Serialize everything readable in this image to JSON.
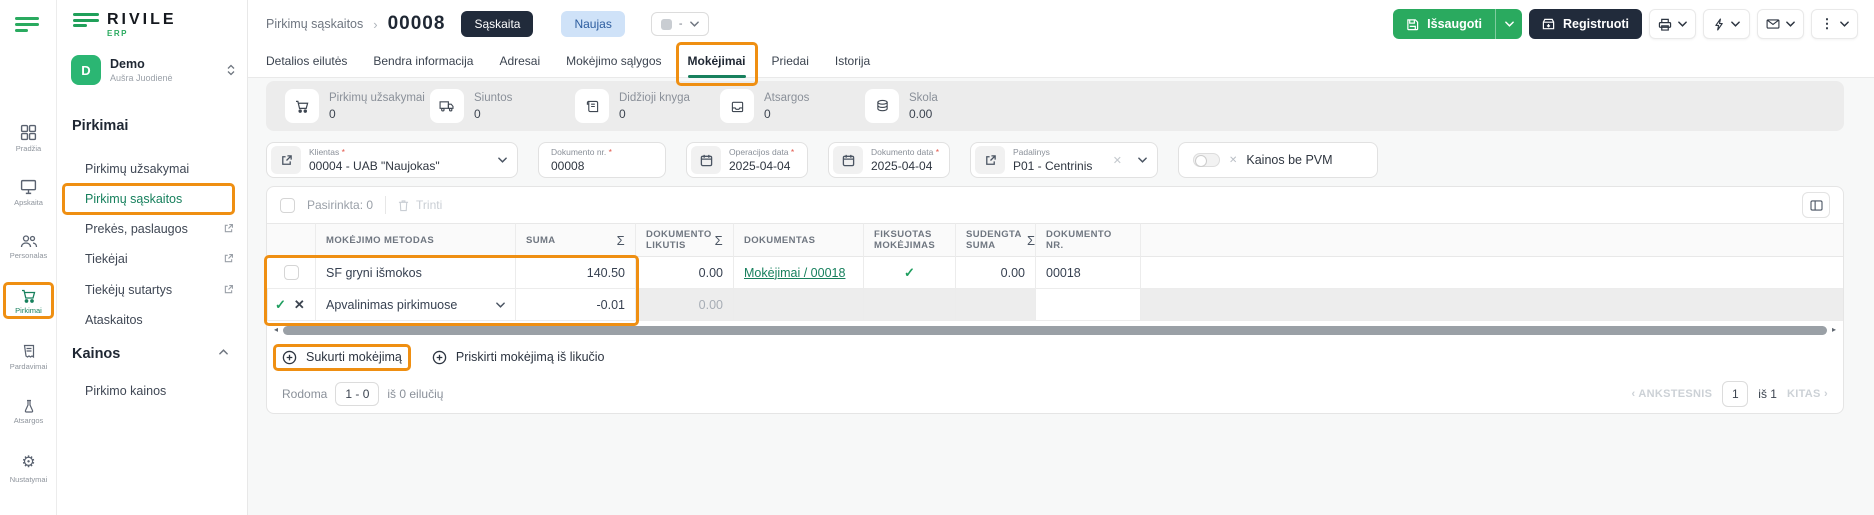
{
  "brand": {
    "name": "RIVILE",
    "sub": "ERP"
  },
  "user": {
    "initial": "D",
    "name": "Demo",
    "subtitle": "Aušra Juodienė"
  },
  "rail": {
    "items": [
      {
        "label": "Pradžia"
      },
      {
        "label": "Apskaita"
      },
      {
        "label": "Personalas"
      },
      {
        "label": "Pirkimai"
      },
      {
        "label": "Pardavimai"
      },
      {
        "label": "Atsargos"
      },
      {
        "label": "Nustatymai"
      }
    ]
  },
  "sidebar": {
    "sections": [
      {
        "heading": "Pirkimai",
        "items": [
          {
            "label": "Pirkimų užsakymai"
          },
          {
            "label": "Pirkimų sąskaitos"
          },
          {
            "label": "Prekės, paslaugos"
          },
          {
            "label": "Tiekėjai"
          },
          {
            "label": "Tiekėjų sutartys"
          },
          {
            "label": "Ataskaitos"
          }
        ]
      },
      {
        "heading": "Kainos",
        "items": [
          {
            "label": "Pirkimo kainos"
          }
        ]
      }
    ]
  },
  "header": {
    "breadcrumb": "Pirkimų sąskaitos",
    "doc_number": "00008",
    "type_badge": "Sąskaita",
    "status_badge": "Naujas",
    "color_dropdown_value": "-",
    "save_label": "Išsaugoti",
    "register_label": "Registruoti"
  },
  "tabs": [
    "Detalios eilutės",
    "Bendra informacija",
    "Adresai",
    "Mokėjimo sąlygos",
    "Mokėjimai",
    "Priedai",
    "Istorija"
  ],
  "stats": [
    {
      "label": "Pirkimų užsakymai",
      "value": "0"
    },
    {
      "label": "Siuntos",
      "value": "0"
    },
    {
      "label": "Didžioji knyga",
      "value": "0"
    },
    {
      "label": "Atsargos",
      "value": "0"
    },
    {
      "label": "Skola",
      "value": "0.00"
    }
  ],
  "fields": {
    "klientas": {
      "label": "Klientas",
      "value": "00004 - UAB \"Naujokas\""
    },
    "dokumento_nr": {
      "label": "Dokumento nr.",
      "value": "00008"
    },
    "operacijos_data": {
      "label": "Operacijos data",
      "value": "2025-04-04"
    },
    "dokumento_data": {
      "label": "Dokumento data",
      "value": "2025-04-04"
    },
    "padalinys": {
      "label": "Padalinys",
      "value": "P01 - Centrinis"
    },
    "kainos_be_pvm": {
      "label": "Kainos be PVM",
      "enabled": false
    }
  },
  "table": {
    "selected_label": "Pasirinkta: 0",
    "delete_label": "Trinti",
    "columns": [
      "MOKĖJIMO METODAS",
      "SUMA",
      "DOKUMENTO LIKUTIS",
      "DOKUMENTAS",
      "FIKSUOTAS MOKĖJIMAS",
      "SUDENGTA SUMA",
      "DOKUMENTO NR."
    ],
    "rows": [
      {
        "metodas": "SF gryni išmokos",
        "suma": "140.50",
        "likutis": "0.00",
        "dokumentas": "Mokėjimai / 00018",
        "fiksuotas": true,
        "sudengta": "0.00",
        "dok_nr": "00018"
      },
      {
        "metodas": "Apvalinimas pirkimuose",
        "suma": "-0.01",
        "likutis": "0.00",
        "editing": true
      }
    ]
  },
  "footer": {
    "create_payment": "Sukurti mokėjimą",
    "assign_payment": "Priskirti mokėjimą iš likučio",
    "showing_label": "Rodoma",
    "range": "1 - 0",
    "total_label": "iš 0 eilučių",
    "prev": "ANKSTESNIS",
    "page": "1",
    "of": "iš 1",
    "next": "KITAS"
  },
  "colors": {
    "green": "#2aaa5f",
    "teal": "#17805d",
    "navy": "#212b3b",
    "annotation_orange": "#ef8f12",
    "status_blue_bg": "#cfe2f8"
  }
}
